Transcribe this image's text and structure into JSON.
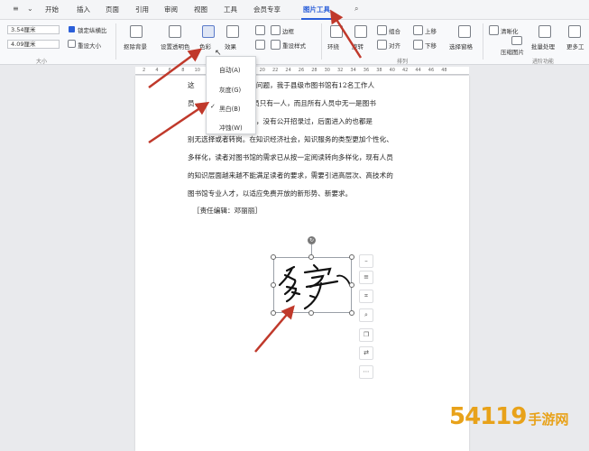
{
  "menubar": {
    "tabs": [
      "开始",
      "插入",
      "页面",
      "引用",
      "审阅",
      "视图",
      "工具",
      "会员专享",
      "图片工具"
    ],
    "active_tab": "图片工具"
  },
  "ribbon": {
    "height_value": "3.54厘米",
    "width_value": "4.09厘米",
    "lock_ratio_label": "锁定纵横比",
    "reset_size_label": "重设大小",
    "size_group_label": "大小",
    "remove_bg_label": "抠除背景",
    "set_transparent_label": "设置透明色",
    "color_label": "色彩",
    "effects_label": "效果",
    "border_label": "边框",
    "reset_style_label": "重设样式",
    "wrap_label": "环绕",
    "rotate_label": "旋转",
    "combine_label": "组合",
    "align_label": "对齐",
    "up_label": "上移",
    "down_label": "下移",
    "select_pane_label": "选择窗格",
    "arrange_group_label": "排列",
    "sharpen_label": "清晰化",
    "compress_label": "压缩图片",
    "batch_label": "批量处理",
    "more_label": "更多工",
    "advanced_group_label": "进阶功能"
  },
  "dropdown": {
    "items": [
      "自动(A)",
      "灰度(G)",
      "黑白(B)",
      "冲蚀(W)"
    ],
    "checked": "黑白(B)"
  },
  "ruler_ticks": [
    "2",
    "4",
    "6",
    "8",
    "10",
    "12",
    "14",
    "16",
    "18",
    "20",
    "22",
    "24",
    "26",
    "28",
    "30",
    "32",
    "34",
    "36",
    "38",
    "40",
    "42",
    "44",
    "46",
    "48"
  ],
  "document": {
    "lines": [
      "这　　　　　　的共性问题，我于县级市图书馆有12名工作人",
      "员，　　　　　学业人员只有一人，而且所有人员中无一是图书",
      "　　　　　　　年以来，没有公开招录过，后面进入的也都是",
      "别无选择或者转岗。在知识经济社会，知识服务的类型更加个性化、",
      "多样化，读者对图书馆的需求已从按一定阅读转向多样化，现有人员",
      "的知识层面越来越不能满足读者的要求，需要引进高层次、高技术的",
      "图书馆专业人才，以适应免费开放的新形势、新要求。"
    ],
    "editor": "［责任编辑：邓丽丽］",
    "signature_text": "名字"
  },
  "watermark": {
    "brand": "54119",
    "site": "手游网"
  },
  "colors": {
    "accent": "#2b5fd9",
    "arrow": "#c0392b"
  }
}
